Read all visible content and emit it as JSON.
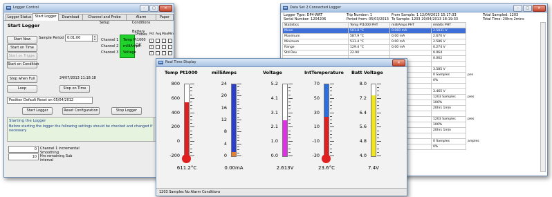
{
  "logger": {
    "title": "Logger Control",
    "tabs": [
      "Logger Status",
      "Start Logger",
      "Download",
      "Channel and Probe Setup",
      "Alarm Conditions",
      "Paper"
    ],
    "section_title": "Start Logger",
    "start_now": "Start Now",
    "start_on_time": "Start on Time",
    "start_on_trigger": "Start on Trigger",
    "start_on_condition": "Start on Condition",
    "sample_period_label": "Sample Period",
    "sample_period_value": "0:01:00",
    "battery_label": "Battery",
    "battery_status": "OK",
    "probes_header": "Probes",
    "col_headers": [
      "Pst",
      "Avg",
      "Max",
      "Min",
      "Hi/lev"
    ],
    "channels": [
      {
        "name": "Channel 1",
        "probe": "Temp Pt1000"
      },
      {
        "name": "Channel 2",
        "probe": "milliAmps"
      },
      {
        "name": "Channel 3",
        "probe": "Voltage"
      }
    ],
    "stop_when_full": "Stop when Full",
    "loop": "Loop",
    "stop_time": "24/07/2013 11:18:18",
    "stop_on_time": "Stop on Time",
    "message": "Position Default Reset on 05/04/2012",
    "start_logger": "Start Logger",
    "reset_config": "Reset Configuration",
    "stop_logger": "Stop Logger",
    "log_title": "Starting the Logger",
    "log_text": "Before starting the logger the following settings should be checked and changed if necessary",
    "bottom_rows": [
      {
        "num": "0",
        "label": "Channel 1 incremental Smoothing"
      },
      {
        "num": "10",
        "label": "Hrs remaining Sub interval"
      }
    ]
  },
  "stats": {
    "title": "Data Set 2 Connected Logger",
    "logger_type_label": "Logger Type:",
    "logger_type": "DP4-WRT",
    "serial_label": "Serial Number:",
    "serial": "1204206",
    "trip_label": "Trip Number:",
    "trip": "1",
    "period_label": "Period from:",
    "period": "05/03/2013",
    "from_label": "From Sample:",
    "from_sample": "1",
    "from_time": "12/04/2013 15:17:33",
    "to_label": "To",
    "to_sample_label": "Sample:",
    "to_sample": "1203",
    "to_time": "20/04/2013 18:19:33",
    "total_samples_label": "Total Sampled:",
    "total_samples": "1203",
    "total_time_label": "Total Time:",
    "total_time": "20hrs 2mins",
    "headers": [
      "Statistics",
      "Temp Pt1000 PHT",
      "milliAmps PHT",
      "mVolts PHT"
    ],
    "rows": [
      [
        "Mean",
        "501.8 °C",
        "0.060 mA",
        "2.5831 V"
      ],
      [
        "Maximum",
        "587.9 °C",
        "0.00 mA",
        "2.670 V"
      ],
      [
        "Minimum",
        "531.4 °C",
        "0.00 mA",
        "2.586 V"
      ],
      [
        "Range",
        "129.4 °C",
        "0.00 mA",
        "0.274 V"
      ],
      [
        "Std Dev",
        "22.90",
        "",
        "0.064"
      ],
      [
        "",
        "",
        "",
        "0.062"
      ],
      [
        "",
        "",
        "",
        ""
      ],
      [
        "",
        "",
        "",
        "3.585 V"
      ],
      [
        "",
        "",
        "",
        "0 Samples"
      ],
      [
        "",
        "",
        "",
        "0%"
      ],
      [
        "",
        "",
        "",
        ""
      ],
      [
        "",
        "",
        "",
        "3.465 V"
      ],
      [
        "",
        "",
        "",
        "1203 Samples"
      ],
      [
        "",
        "",
        "",
        "100%"
      ],
      [
        "",
        "",
        "",
        "20hrs 1min"
      ],
      [
        "",
        "",
        "",
        ""
      ],
      [
        "",
        "",
        "",
        "1203 Samples"
      ],
      [
        "",
        "",
        "",
        "100%"
      ],
      [
        "",
        "",
        "",
        "20hrs 1min"
      ],
      [
        "",
        "",
        "",
        ""
      ],
      [
        "",
        "",
        "",
        "0 Samples"
      ],
      [
        "",
        "",
        "",
        "0%"
      ]
    ],
    "side_labels": [
      "",
      "",
      "",
      "",
      "",
      "",
      "",
      "",
      "pes",
      "",
      "",
      "",
      "ples",
      "",
      "",
      "",
      "ples",
      "",
      "",
      "",
      "amples",
      ""
    ]
  },
  "realtime": {
    "title": "Real Time Display",
    "status": "1203 Samples   No Alarm Conditions",
    "gauges": [
      {
        "title": "Temp Pt1000",
        "ticks": [
          "800",
          "600",
          "400",
          "200",
          "0",
          "-200"
        ],
        "value_text": "611.2°C",
        "fill_fraction": 0.75,
        "color": "#e02020",
        "bulb": true
      },
      {
        "title": "milliAmps",
        "ticks": [
          "24",
          "20",
          "16",
          "12",
          "8",
          "4",
          "0"
        ],
        "value_text": "0.00mA",
        "fill_fraction": 0.06,
        "color": "#e87f2a",
        "top_color": "#2a3fd0",
        "bulb": false
      },
      {
        "title": "Voltage",
        "ticks": [
          "5.2",
          "4.1",
          "3.1",
          "2.1",
          "1.0",
          "0.0"
        ],
        "value_text": "2.613V",
        "fill_fraction": 0.5,
        "color": "#e02fe6",
        "bulb": false
      },
      {
        "title": "IntTemperature",
        "ticks": [
          "70",
          "50",
          "30",
          "10",
          "-10",
          "-30"
        ],
        "value_text": "23.6°C",
        "fill_fraction": 0.55,
        "color": "#e02020",
        "top_color": "#2a6fe0",
        "bulb": true
      },
      {
        "title": "Batt Voltage",
        "ticks": [
          "8.0",
          "7.2",
          "6.4",
          "5.6",
          "4.8",
          "4.0"
        ],
        "value_text": "7.4V",
        "fill_fraction": 0.85,
        "color": "#f1e81b",
        "bulb": false
      }
    ]
  }
}
